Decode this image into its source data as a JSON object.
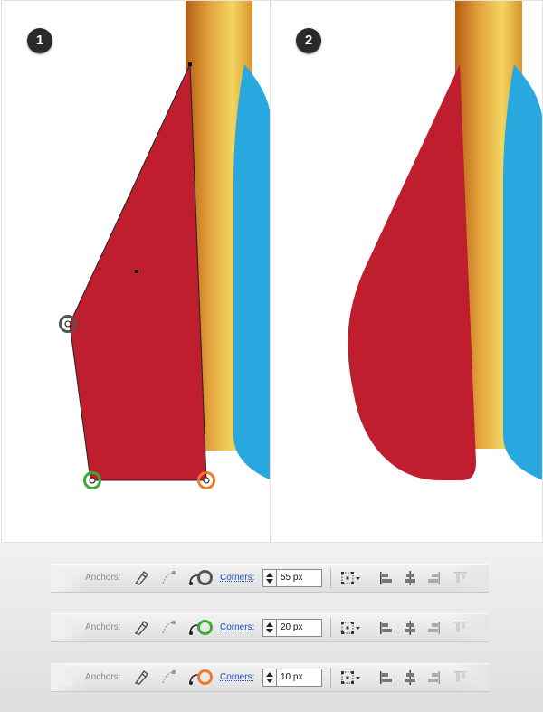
{
  "steps": {
    "step1_number": "1",
    "step2_number": "2"
  },
  "colors": {
    "red_shape": "#be1e2d",
    "blue_shape": "#29a8e0",
    "gold_dark": "#c8761e",
    "gold_light": "#f3d560",
    "ring_gray": "#555555",
    "ring_green": "#3aaa35",
    "ring_orange": "#f07a2a"
  },
  "anchors": [
    {
      "name": "top",
      "ring": "none"
    },
    {
      "name": "left-middle",
      "ring": "gray"
    },
    {
      "name": "bottom-left",
      "ring": "green"
    },
    {
      "name": "bottom-right",
      "ring": "orange"
    }
  ],
  "toolbars": [
    {
      "anchors_label": "Anchors:",
      "corners_label": "Corners:",
      "corners_value": "55 px",
      "ring": "gray",
      "icons": [
        "convert-anchor-icon",
        "handle-icon",
        "corner-widget-icon",
        "transform-icon",
        "align-left-icon",
        "align-center-icon",
        "align-right-icon",
        "align-top-icon"
      ]
    },
    {
      "anchors_label": "Anchors:",
      "corners_label": "Corners:",
      "corners_value": "20 px",
      "ring": "green",
      "icons": [
        "convert-anchor-icon",
        "handle-icon",
        "corner-widget-icon",
        "transform-icon",
        "align-left-icon",
        "align-center-icon",
        "align-right-icon",
        "align-top-icon"
      ]
    },
    {
      "anchors_label": "Anchors:",
      "corners_label": "Corners:",
      "corners_value": "10 px",
      "ring": "orange",
      "icons": [
        "convert-anchor-icon",
        "handle-icon",
        "corner-widget-icon",
        "transform-icon",
        "align-left-icon",
        "align-center-icon",
        "align-right-icon",
        "align-top-icon"
      ]
    }
  ]
}
